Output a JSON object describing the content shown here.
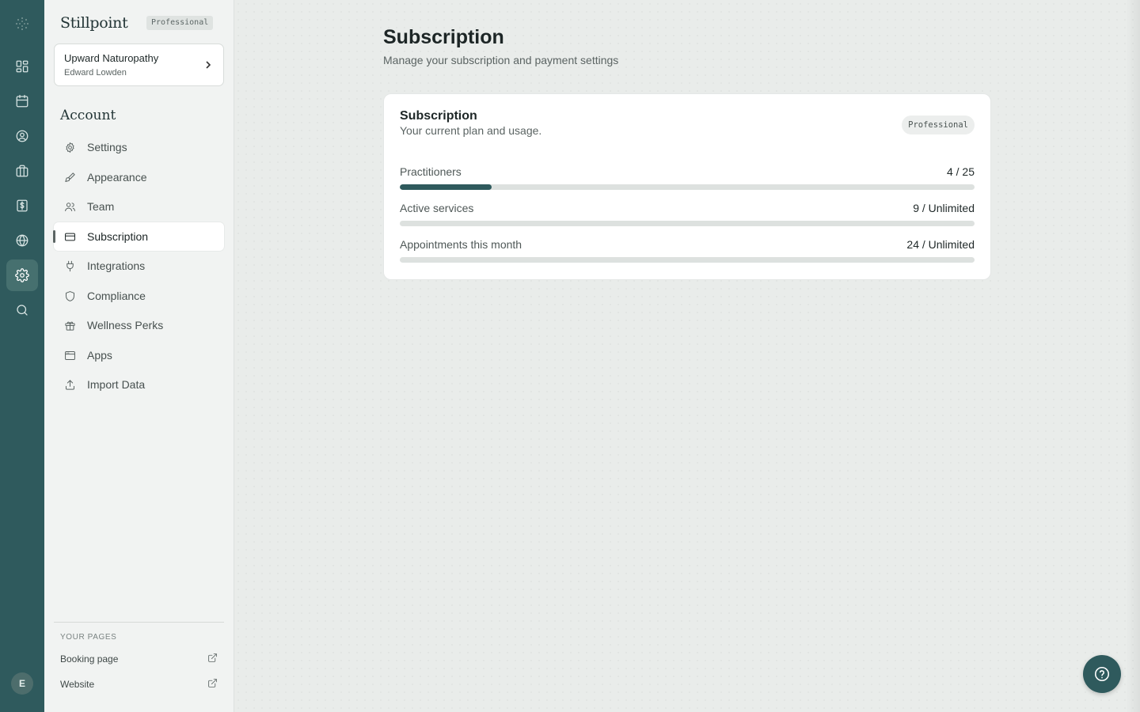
{
  "brand": {
    "name": "Stillpoint",
    "plan_tag": "Professional"
  },
  "org": {
    "name": "Upward Naturopathy",
    "user": "Edward Lowden"
  },
  "rail": {
    "avatar_initial": "E",
    "items": [
      "dashboard-icon",
      "calendar-icon",
      "user-circle-icon",
      "briefcase-icon",
      "billing-icon",
      "globe-icon",
      "gear-icon",
      "search-icon"
    ],
    "active": "gear-icon"
  },
  "sidebar": {
    "section_title": "Account",
    "items": [
      {
        "label": "Settings",
        "icon": "gear-icon"
      },
      {
        "label": "Appearance",
        "icon": "paintbrush-icon"
      },
      {
        "label": "Team",
        "icon": "users-icon"
      },
      {
        "label": "Subscription",
        "icon": "credit-card-icon",
        "active": true
      },
      {
        "label": "Integrations",
        "icon": "plug-icon"
      },
      {
        "label": "Compliance",
        "icon": "shield-icon"
      },
      {
        "label": "Wellness Perks",
        "icon": "gift-icon"
      },
      {
        "label": "Apps",
        "icon": "app-window-icon"
      },
      {
        "label": "Import Data",
        "icon": "upload-icon"
      }
    ],
    "pages_heading": "YOUR PAGES",
    "pages": [
      {
        "label": "Booking page",
        "icon": "external-link-icon"
      },
      {
        "label": "Website",
        "icon": "external-link-icon"
      }
    ]
  },
  "main": {
    "title": "Subscription",
    "subtitle": "Manage your subscription and payment settings",
    "card": {
      "title": "Subscription",
      "subtitle": "Your current plan and usage.",
      "badge": "Professional",
      "usage": [
        {
          "label": "Practitioners",
          "value": "4 / 25",
          "fraction": 0.16
        },
        {
          "label": "Active services",
          "value": "9 / Unlimited",
          "fraction": 0
        },
        {
          "label": "Appointments this month",
          "value": "24 / Unlimited",
          "fraction": 0
        }
      ]
    }
  },
  "colors": {
    "accent": "#2f5a5d",
    "rail_bg": "#2f5a5d",
    "page_bg": "#e9ecea"
  }
}
